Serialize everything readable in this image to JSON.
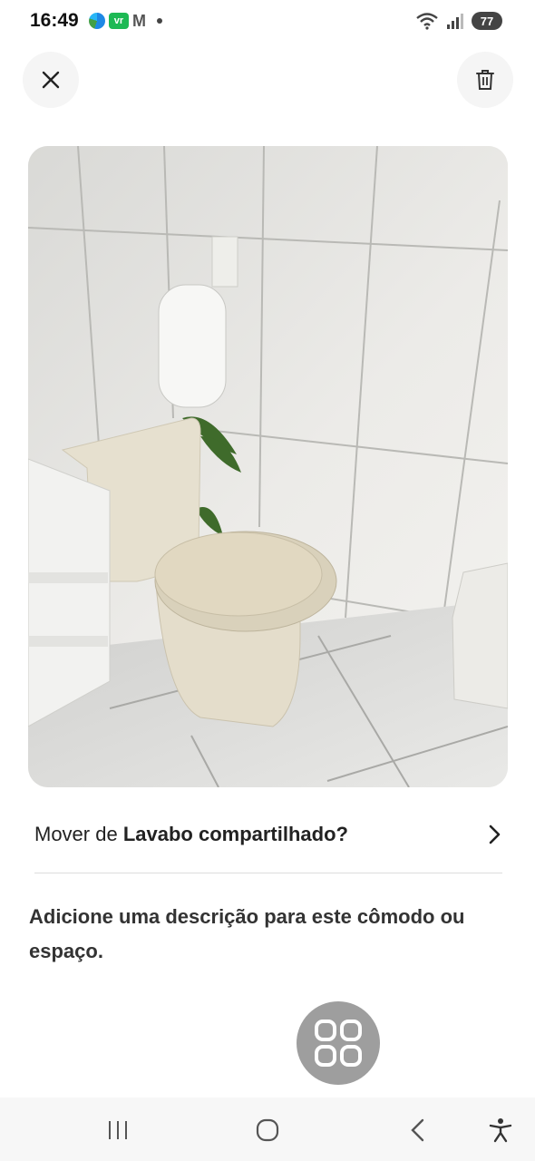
{
  "status_bar": {
    "time": "16:49",
    "apps": [
      "edge-icon",
      "vr-icon",
      "gmail-icon"
    ],
    "vr_label": "vr",
    "gmail_label": "M",
    "battery": "77"
  },
  "header": {
    "close_icon": "close-icon",
    "delete_icon": "trash-icon"
  },
  "photo": {
    "subject": "bathroom-photo"
  },
  "move": {
    "prefix": "Mover de ",
    "room": "Lavabo compartilhado?"
  },
  "description": {
    "text": "Adicione uma descrição para este cômodo ou espaço."
  },
  "nav": {
    "recent": "recent-apps-icon",
    "home": "home-icon",
    "back": "back-icon",
    "accessibility": "accessibility-icon"
  },
  "colors": {
    "photo_wall": "#e7e5e2",
    "fab": "#9e9e9e"
  }
}
